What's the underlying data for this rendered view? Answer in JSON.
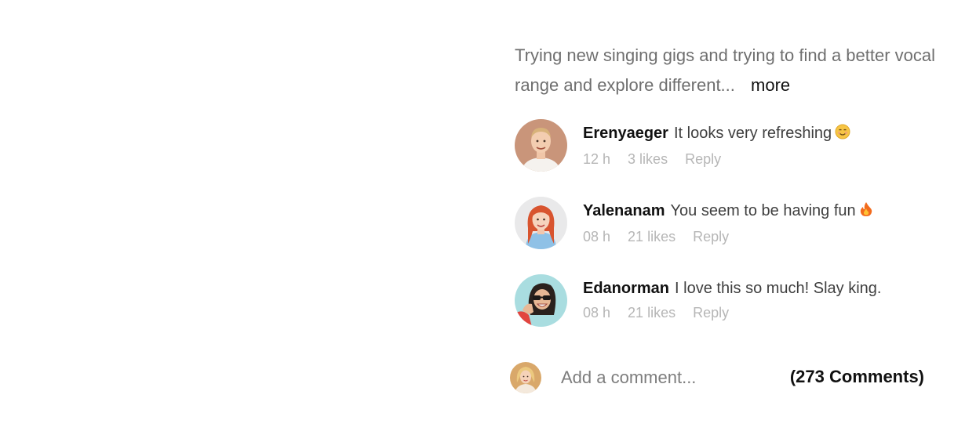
{
  "post": {
    "caption": "Trying new singing gigs and trying to find a better vocal range and explore different...",
    "more_label": "more"
  },
  "comments": [
    {
      "user": "Erenyaeger",
      "text": "It looks very refreshing",
      "emoji": "smiling-face-icon",
      "time": "12 h",
      "likes": "3 likes",
      "reply": "Reply"
    },
    {
      "user": "Yalenanam",
      "text": "You seem to be having fun",
      "emoji": "fire-icon",
      "time": "08 h",
      "likes": "21 likes",
      "reply": "Reply"
    },
    {
      "user": "Edanorman",
      "text": "I love this so much! Slay king.",
      "time": "08 h",
      "likes": "21 likes",
      "reply": "Reply"
    }
  ],
  "add_comment": {
    "placeholder": "Add a comment...",
    "count_label": "(273 Comments)"
  },
  "colors": {
    "caption": "#6f6f6f",
    "meta": "#b6b6b6",
    "text_dark": "#111111"
  }
}
